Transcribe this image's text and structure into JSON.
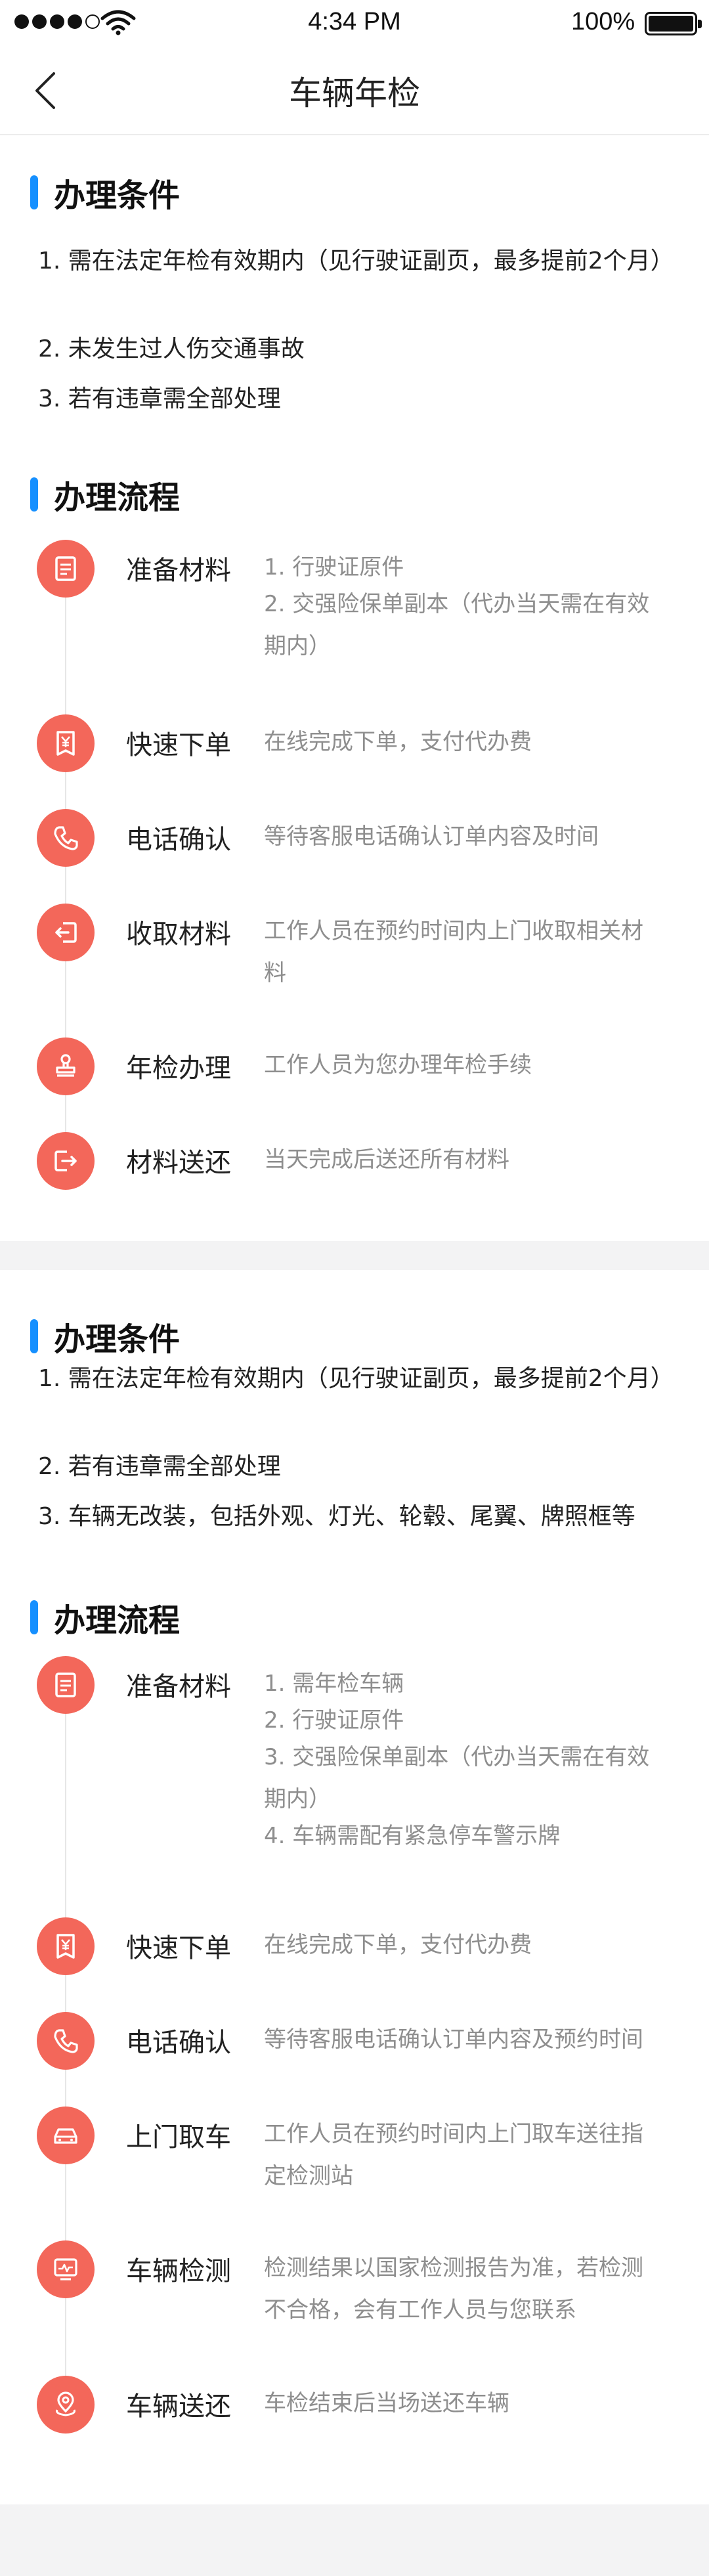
{
  "status_bar": {
    "time": "4:34 PM",
    "battery": "100%"
  },
  "nav": {
    "title": "车辆年检"
  },
  "section1": {
    "conditions_title": "办理条件",
    "conditions": [
      "1. 需在法定年检有效期内（见行驶证副页，最多提前2个月）",
      "2. 未发生过人伤交通事故",
      "3. 若有违章需全部处理"
    ],
    "process_title": "办理流程",
    "steps": [
      {
        "name": "准备材料",
        "lines": [
          "1. 行驶证原件",
          "2. 交强险保单副本（代办当天需在有效期内）"
        ],
        "icon": "document-icon"
      },
      {
        "name": "快速下单",
        "lines": [
          "在线完成下单，支付代办费"
        ],
        "icon": "receipt-yen-icon"
      },
      {
        "name": "电话确认",
        "lines": [
          "等待客服电话确认订单内容及时间"
        ],
        "icon": "phone-icon"
      },
      {
        "name": "收取材料",
        "lines": [
          "工作人员在预约时间内上门收取相关材料"
        ],
        "icon": "collect-icon"
      },
      {
        "name": "年检办理",
        "lines": [
          "工作人员为您办理年检手续"
        ],
        "icon": "stamp-icon"
      },
      {
        "name": "材料送还",
        "lines": [
          "当天完成后送还所有材料"
        ],
        "icon": "return-icon"
      }
    ]
  },
  "section2": {
    "conditions_title": "办理条件",
    "conditions": [
      "1. 需在法定年检有效期内（见行驶证副页，最多提前2个月）",
      "2. 若有违章需全部处理",
      "3. 车辆无改装，包括外观、灯光、轮毂、尾翼、牌照框等"
    ],
    "process_title": "办理流程",
    "steps": [
      {
        "name": "准备材料",
        "lines": [
          "1. 需年检车辆",
          "2. 行驶证原件",
          "3. 交强险保单副本（代办当天需在有效期内）",
          "4. 车辆需配有紧急停车警示牌"
        ],
        "icon": "document-icon"
      },
      {
        "name": "快速下单",
        "lines": [
          "在线完成下单，支付代办费"
        ],
        "icon": "receipt-yen-icon"
      },
      {
        "name": "电话确认",
        "lines": [
          "等待客服电话确认订单内容及预约时间"
        ],
        "icon": "phone-icon"
      },
      {
        "name": "上门取车",
        "lines": [
          "工作人员在预约时间内上门取车送往指定检测站"
        ],
        "icon": "car-icon"
      },
      {
        "name": "车辆检测",
        "lines": [
          "检测结果以国家检测报告为准，若检测不合格，会有工作人员与您联系"
        ],
        "icon": "monitor-icon"
      },
      {
        "name": "车辆送还",
        "lines": [
          "车检结束后当场送还车辆"
        ],
        "icon": "location-icon"
      }
    ]
  }
}
